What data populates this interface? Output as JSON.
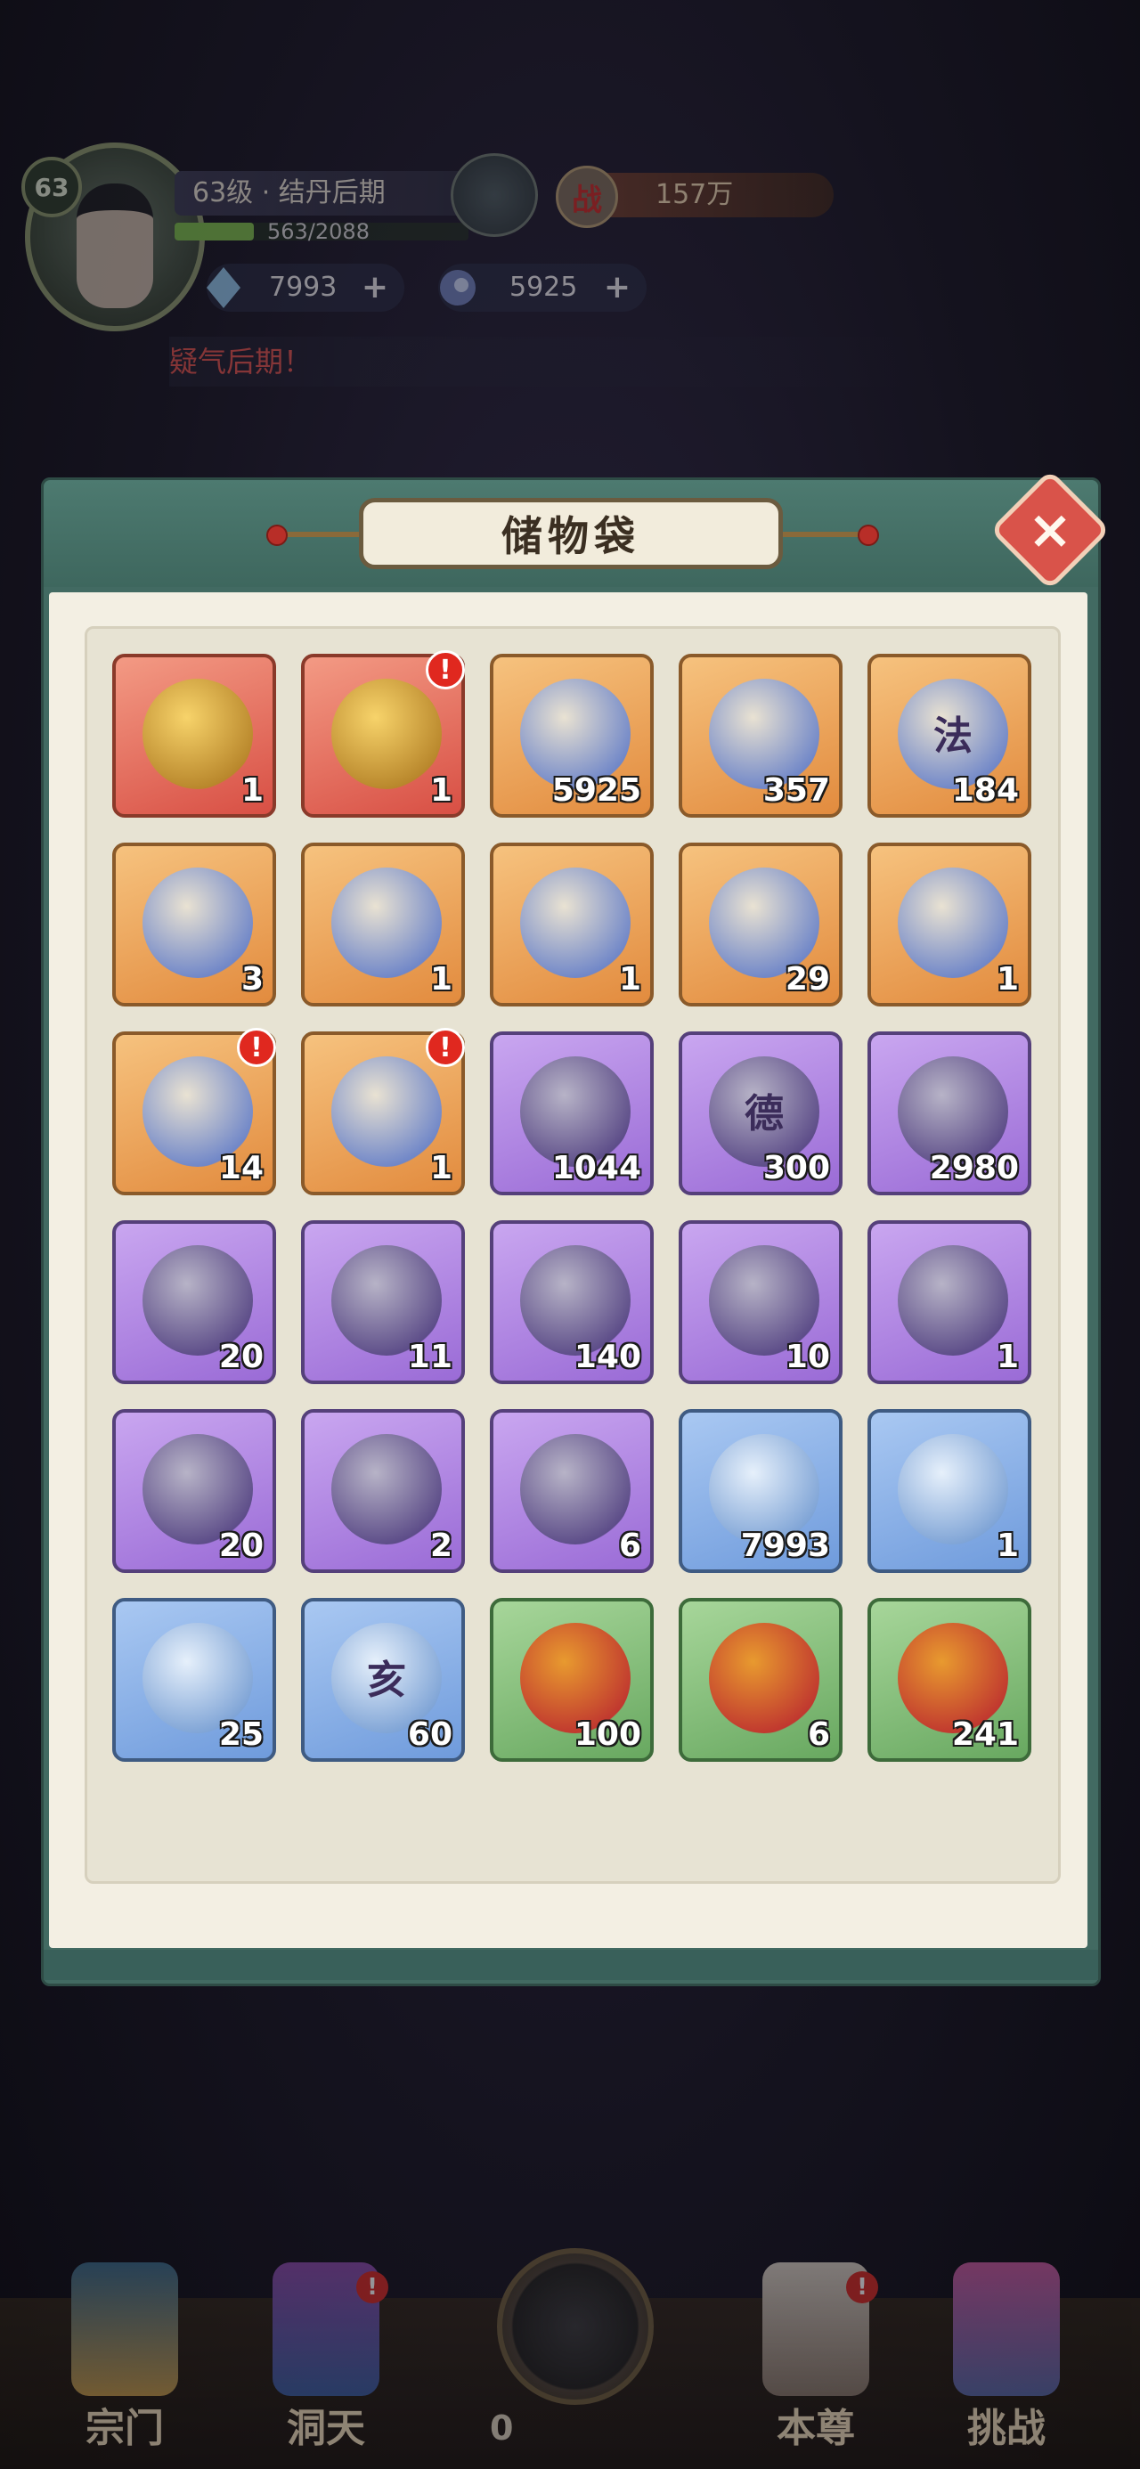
{
  "player": {
    "level_badge": "63",
    "realm": "63级 · 结丹后期",
    "exp_text": "563/2088",
    "exp_fraction": 0.27,
    "combat_power": "157万",
    "power_icon": "战",
    "gems": "7993",
    "spirit_stones": "5925",
    "notice": "疑气后期！"
  },
  "panel": {
    "title": "储物袋",
    "close_icon": "×"
  },
  "items": [
    {
      "name": "golden-treasure-bag",
      "qty": "1",
      "rarity": "red",
      "alert": false
    },
    {
      "name": "red-manual-book",
      "qty": "1",
      "rarity": "red",
      "alert": true
    },
    {
      "name": "blue-swirl-orb",
      "qty": "5925",
      "rarity": "orange",
      "alert": false
    },
    {
      "name": "white-claw-ornament",
      "qty": "357",
      "rarity": "orange",
      "alert": false
    },
    {
      "name": "fa-talisman-token",
      "qty": "184",
      "rarity": "orange",
      "alert": false,
      "glyph": "法"
    },
    {
      "name": "jade-lion-statue",
      "qty": "3",
      "rarity": "orange",
      "alert": false
    },
    {
      "name": "golden-bangle",
      "qty": "1",
      "rarity": "orange",
      "alert": false
    },
    {
      "name": "green-scroll-cards",
      "qty": "1",
      "rarity": "orange",
      "alert": false
    },
    {
      "name": "spirit-map-scroll",
      "qty": "29",
      "rarity": "orange",
      "alert": false
    },
    {
      "name": "crystal-ball-stand",
      "qty": "1",
      "rarity": "orange",
      "alert": false
    },
    {
      "name": "lucky-golden-pouch",
      "qty": "14",
      "rarity": "orange",
      "alert": true
    },
    {
      "name": "brown-manual-book",
      "qty": "1",
      "rarity": "orange",
      "alert": true
    },
    {
      "name": "grey-ore-stone",
      "qty": "1044",
      "rarity": "purple",
      "alert": false
    },
    {
      "name": "de-coin-medal",
      "qty": "300",
      "rarity": "purple",
      "alert": false,
      "glyph": "德"
    },
    {
      "name": "purple-rune-orb",
      "qty": "2980",
      "rarity": "purple",
      "alert": false
    },
    {
      "name": "yellow-crystal-shard",
      "qty": "20",
      "rarity": "purple",
      "alert": false
    },
    {
      "name": "dark-ring",
      "qty": "11",
      "rarity": "purple",
      "alert": false
    },
    {
      "name": "spirit-flame",
      "qty": "140",
      "rarity": "purple",
      "alert": false
    },
    {
      "name": "jade-vase-sprig",
      "qty": "10",
      "rarity": "purple",
      "alert": false
    },
    {
      "name": "golden-seal-card",
      "qty": "1",
      "rarity": "purple",
      "alert": false
    },
    {
      "name": "rose-pearl-flower",
      "qty": "20",
      "rarity": "purple",
      "alert": false
    },
    {
      "name": "ice-feather-blade",
      "qty": "2",
      "rarity": "purple",
      "alert": false
    },
    {
      "name": "amber-flame-crystal",
      "qty": "6",
      "rarity": "purple",
      "alert": false
    },
    {
      "name": "blue-diamond-gem",
      "qty": "7993",
      "rarity": "blue",
      "alert": false
    },
    {
      "name": "wind-swirl-orb",
      "qty": "1",
      "rarity": "blue",
      "alert": false
    },
    {
      "name": "ice-crystal-cluster",
      "qty": "25",
      "rarity": "blue",
      "alert": false
    },
    {
      "name": "qi-scroll-paper",
      "qty": "60",
      "rarity": "blue",
      "alert": false,
      "glyph": "亥"
    },
    {
      "name": "red-fruit-gourd",
      "qty": "100",
      "rarity": "green",
      "alert": false
    },
    {
      "name": "golden-dragon-orb",
      "qty": "6",
      "rarity": "green",
      "alert": false
    },
    {
      "name": "green-herb-leaf",
      "qty": "241",
      "rarity": "green",
      "alert": false
    }
  ],
  "nav": {
    "sect": "宗门",
    "cave": "洞天",
    "center_count": "0",
    "self": "本尊",
    "challenge": "挑战",
    "alert": "!"
  }
}
